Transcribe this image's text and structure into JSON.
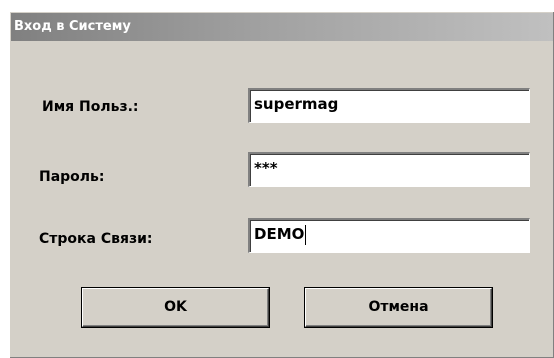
{
  "window": {
    "title": "Вход в Систему"
  },
  "form": {
    "username": {
      "label": "Имя Польз.:",
      "value": "supermag"
    },
    "password": {
      "label": "Пароль:",
      "value": "***"
    },
    "connection": {
      "label": "Строка Связи:",
      "value": "DEMO"
    }
  },
  "buttons": {
    "ok_label": "OK",
    "cancel_label": "Отмена"
  }
}
